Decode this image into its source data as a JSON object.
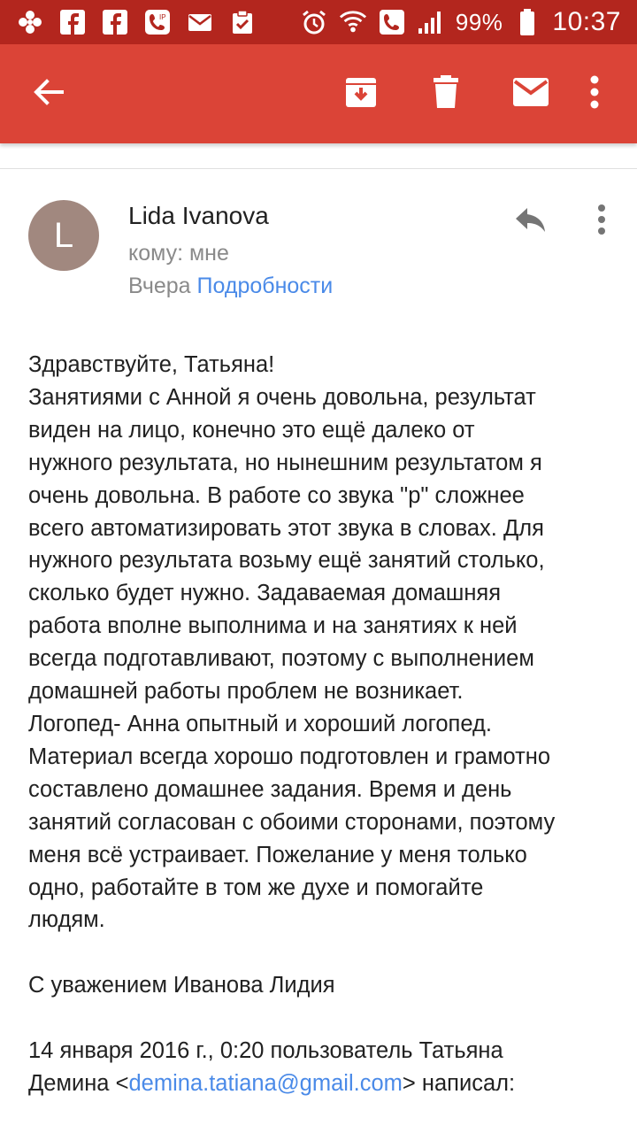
{
  "status_bar": {
    "left_icons": [
      "pinwheel-icon",
      "facebook-icon",
      "facebook-icon",
      "voip-phone-icon",
      "mail-icon",
      "clipboard-check-icon"
    ],
    "battery": "99%",
    "time": "10:37"
  },
  "toolbar": {
    "back": "back-arrow-icon",
    "archive": "archive-icon",
    "delete": "trash-icon",
    "mark_unread": "envelope-icon",
    "overflow": "more-vert-icon"
  },
  "message": {
    "avatar_letter": "L",
    "sender": "Lida Ivanova",
    "recipient_line": "кому: мне",
    "date": "Вчера",
    "details_link": "Подробности",
    "body_lines": [
      "Здравствуйте, Татьяна!",
      "Занятиями с Анной я очень довольна, результат",
      "виден на лицо, конечно это ещё далеко от",
      "нужного результата, но нынешним результатом я",
      "очень довольна. В работе со звука \"р\" сложнее",
      "всего автоматизировать этот звука в словах. Для",
      "нужного результата возьму ещё занятий столько,",
      "сколько будет нужно. Задаваемая домашняя",
      "работа вполне выполнима и на занятиях к ней",
      "всегда подготавливают, поэтому с выполнением",
      "домашней работы проблем не возникает.",
      "Логопед- Анна опытный и хороший логопед.",
      "Материал всегда хорошо подготовлен и грамотно",
      "составлено домашнее задания. Время и день",
      "занятий согласован с обоими сторонами, поэтому",
      "меня всё устраивает. Пожелание у меня только",
      "одно, работайте в том же духе и помогайте",
      "людям."
    ],
    "signature": "С уважением Иванова Лидия",
    "quote_line1": "14 января 2016 г., 0:20 пользователь Татьяна",
    "quote_name": "Демина",
    "quote_open": "<",
    "quote_email": "demina.tatiana@gmail.com",
    "quote_close": ">",
    "quote_suffix": "написал:"
  },
  "colors": {
    "status_bar": "#b3261e",
    "app_bar": "#db4437",
    "link": "#4a8ae8",
    "avatar": "#a1887f"
  }
}
